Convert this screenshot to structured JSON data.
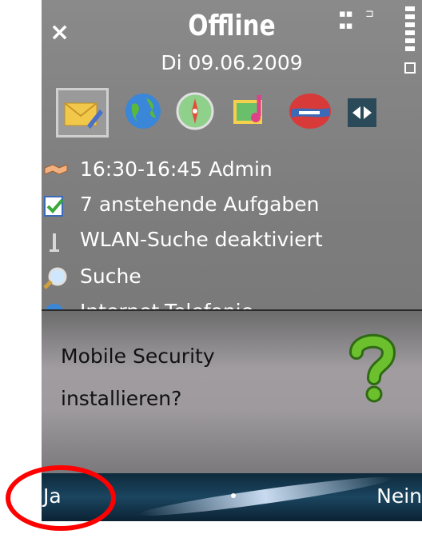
{
  "status_bar": {
    "profile": "Offline",
    "date": "Di 09.06.2009",
    "close_symbol": "×",
    "mode_icon": "grid-icon",
    "signal_icon": "connection-icon",
    "battery_icon": "battery-icon"
  },
  "apps": [
    "messaging-icon",
    "web-globe-icon",
    "compass-icon",
    "gallery-icon",
    "chat-icon",
    "switch-icon"
  ],
  "list": [
    {
      "icon": "handshake-icon",
      "label": "16:30-16:45 Admin"
    },
    {
      "icon": "tasks-icon",
      "label": "7 anstehende Aufgaben"
    },
    {
      "icon": "wlan-icon",
      "label": "WLAN-Suche deaktiviert"
    },
    {
      "icon": "search-icon",
      "label": "Suche"
    },
    {
      "icon": "globe-icon",
      "label": "Internet-Telefonie"
    }
  ],
  "dialog": {
    "message": "Mobile Security installieren?",
    "icon": "question-mark-icon"
  },
  "softkeys": {
    "left": "Ja",
    "right": "Nein"
  },
  "colors": {
    "highlight_ring": "#ff0000",
    "question_green": "#5aa828"
  }
}
